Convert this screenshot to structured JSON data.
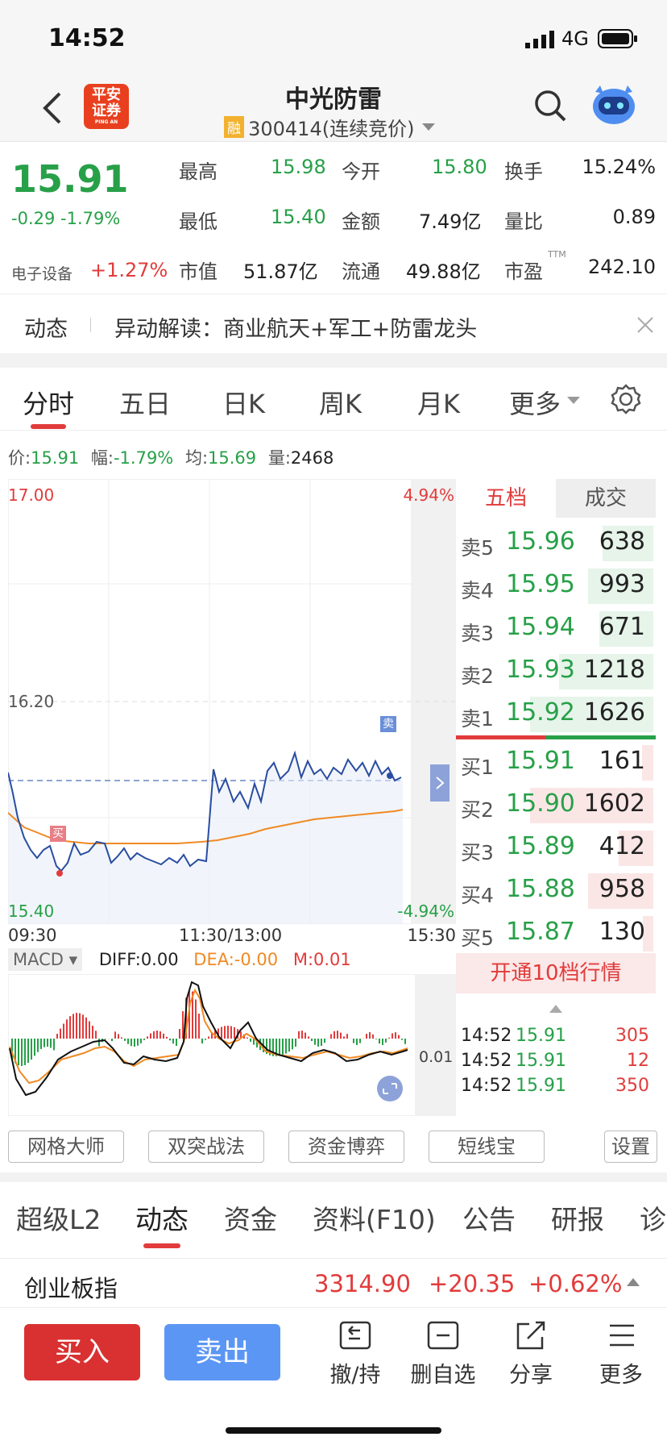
{
  "status": {
    "time": "14:52",
    "network": "4G"
  },
  "nav": {
    "title": "中光防雷",
    "rong_badge": "融",
    "code_line": "300414(连续竞价)",
    "logo_line1": "平安",
    "logo_line2": "证券",
    "logo_sub": "PING AN"
  },
  "quote": {
    "price": "15.91",
    "change": "-0.29",
    "change_pct": "-1.79%",
    "sector_name": "电子设备",
    "sector_change": "+1.27%",
    "high_label": "最高",
    "high": "15.98",
    "open_label": "今开",
    "open": "15.80",
    "turnover_label": "换手",
    "turnover": "15.24%",
    "low_label": "最低",
    "low": "15.40",
    "amount_label": "金额",
    "amount": "7.49亿",
    "vol_ratio_label": "量比",
    "vol_ratio": "0.89",
    "mcap_label": "市值",
    "mcap": "51.87亿",
    "float_label": "流通",
    "float_cap": "49.88亿",
    "pe_label": "市盈",
    "pe_sup": "TTM",
    "pe": "242.10"
  },
  "news": {
    "tag": "动态",
    "text": "异动解读：商业航天+军工+防雷龙头"
  },
  "chart_tabs": [
    "分时",
    "五日",
    "日K",
    "周K",
    "月K",
    "更多"
  ],
  "info_bar": {
    "price_label": "价:",
    "price": "15.91",
    "amp_label": "幅:",
    "amp": "-1.79%",
    "avg_label": "均:",
    "avg": "15.69",
    "vol_label": "量:",
    "vol": "2468"
  },
  "chart_labels": {
    "top_price": "17.00",
    "mid_price": "16.20",
    "low_price": "15.40",
    "top_pct": "4.94%",
    "low_pct": "-4.94%",
    "t_start": "09:30",
    "t_mid": "11:30/13:00",
    "t_end": "15:30",
    "buy_mark": "买",
    "sell_mark": "卖"
  },
  "macd": {
    "name": "MACD",
    "diff": "DIFF:0.00",
    "dea": "DEA:-0.00",
    "m": "M:0.01",
    "right_value": "0.01"
  },
  "orderbook": {
    "tab_active": "五档",
    "tab_other": "成交",
    "asks": [
      {
        "label": "卖5",
        "price": "15.96",
        "vol": "638",
        "bar": 0.35
      },
      {
        "label": "卖4",
        "price": "15.95",
        "vol": "993",
        "bar": 0.45
      },
      {
        "label": "卖3",
        "price": "15.94",
        "vol": "671",
        "bar": 0.37
      },
      {
        "label": "卖2",
        "price": "15.93",
        "vol": "1218",
        "bar": 0.65
      },
      {
        "label": "卖1",
        "price": "15.92",
        "vol": "1626",
        "bar": 0.85
      }
    ],
    "bids": [
      {
        "label": "买1",
        "price": "15.91",
        "vol": "161",
        "bar": 0.08
      },
      {
        "label": "买2",
        "price": "15.90",
        "vol": "1602",
        "bar": 0.85
      },
      {
        "label": "买3",
        "price": "15.89",
        "vol": "412",
        "bar": 0.24
      },
      {
        "label": "买4",
        "price": "15.88",
        "vol": "958",
        "bar": 0.45
      },
      {
        "label": "买5",
        "price": "15.87",
        "vol": "130",
        "bar": 0.07
      }
    ],
    "open_l2": "开通10档行情",
    "trades": [
      {
        "time": "14:52",
        "price": "15.91",
        "vol": "305"
      },
      {
        "time": "14:52",
        "price": "15.91",
        "vol": "12"
      },
      {
        "time": "14:52",
        "price": "15.91",
        "vol": "350"
      }
    ]
  },
  "tools": [
    "网格大师",
    "双突战法",
    "资金博弈",
    "短线宝"
  ],
  "settings_label": "设置",
  "bottom_tabs": [
    "超级L2",
    "动态",
    "资金",
    "资料(F10)",
    "公告",
    "研报",
    "诊"
  ],
  "index": {
    "name": "创业板指",
    "value": "3314.90",
    "change": "+20.35",
    "pct": "+0.62%"
  },
  "actions": {
    "buy": "买入",
    "sell": "卖出",
    "cancel": "撤/持",
    "remove_fav": "删自选",
    "share": "分享",
    "more": "更多"
  },
  "colors": {
    "up": "#e23b3b",
    "down": "#27a048",
    "price_line": "#2a4da0",
    "avg_line": "#f08a24",
    "buy_button": "#d93131",
    "sell_button": "#5b96f5"
  }
}
